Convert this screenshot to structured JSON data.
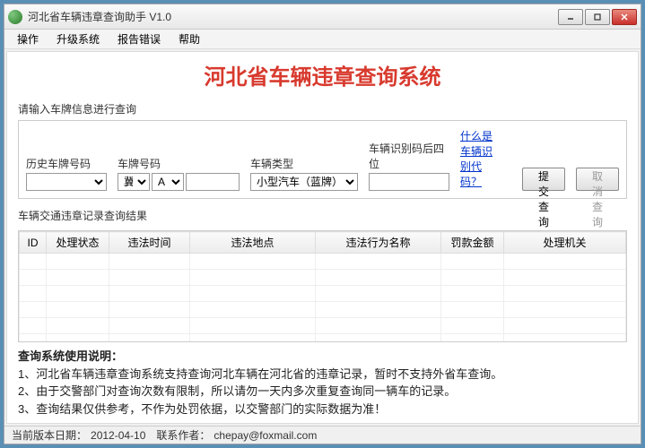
{
  "window": {
    "title": "河北省车辆违章查询助手 V1.0"
  },
  "menu": {
    "items": [
      "操作",
      "升级系统",
      "报告错误",
      "帮助"
    ]
  },
  "main_title": "河北省车辆违章查询系统",
  "form": {
    "section_label": "请输入车牌信息进行查询",
    "history_label": "历史车牌号码",
    "history_value": "",
    "plate_label": "车牌号码",
    "plate_prov": "冀",
    "plate_letter": "A",
    "plate_number": "",
    "type_label": "车辆类型",
    "type_value": "小型汽车（蓝牌）",
    "vin_label": "车辆识别码后四位",
    "vin_value": "",
    "help_link": "什么是车辆识别代码？",
    "submit": "提交查询",
    "cancel": "取消查询"
  },
  "results": {
    "section_label": "车辆交通违章记录查询结果",
    "columns": [
      "ID",
      "处理状态",
      "违法时间",
      "违法地点",
      "违法行为名称",
      "罚款金额",
      "处理机关"
    ]
  },
  "instructions": {
    "title": "查询系统使用说明：",
    "lines": [
      "1、河北省车辆违章查询系统支持查询河北车辆在河北省的违章记录，暂时不支持外省车查询。",
      "2、由于交警部门对查询次数有限制，所以请勿一天内多次重复查询同一辆车的记录。",
      "3、查询结果仅供参考，不作为处罚依据，以交警部门的实际数据为准！"
    ]
  },
  "status": {
    "version_label": "当前版本日期：",
    "version_date": "2012-04-10",
    "contact_label": "联系作者：",
    "contact_value": "chepay@foxmail.com"
  }
}
